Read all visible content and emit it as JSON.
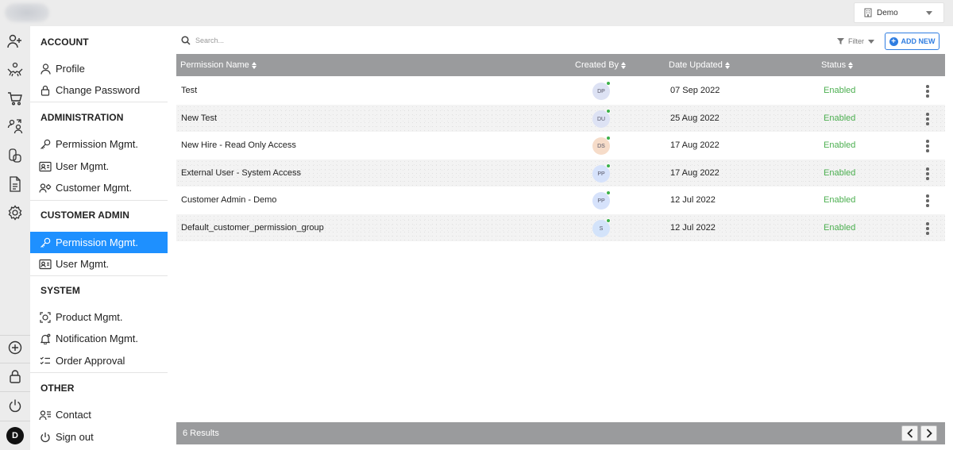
{
  "header": {
    "org_selector": {
      "value": "Demo"
    }
  },
  "rail": {
    "icons": [
      "add-user-icon",
      "handshake-icon",
      "cart-icon",
      "users-switch-icon",
      "coins-icon",
      "document-icon",
      "gear-icon",
      "plus-circle-icon",
      "lock-icon",
      "power-icon"
    ],
    "user_initial": "D"
  },
  "sidebar": {
    "sections": [
      {
        "title": "ACCOUNT",
        "items": [
          {
            "label": "Profile",
            "icon": "user-icon"
          },
          {
            "label": "Change Password",
            "icon": "lock-icon"
          }
        ]
      },
      {
        "title": "ADMINISTRATION",
        "items": [
          {
            "label": "Permission Mgmt.",
            "icon": "key-icon"
          },
          {
            "label": "User Mgmt.",
            "icon": "id-card-icon"
          },
          {
            "label": "Customer Mgmt.",
            "icon": "customer-icon"
          }
        ]
      },
      {
        "title": "CUSTOMER ADMIN",
        "items": [
          {
            "label": "Permission Mgmt.",
            "icon": "key-icon",
            "active": true
          },
          {
            "label": "User Mgmt.",
            "icon": "id-card-icon"
          }
        ]
      },
      {
        "title": "SYSTEM",
        "items": [
          {
            "label": "Product Mgmt.",
            "icon": "product-icon"
          },
          {
            "label": "Notification Mgmt.",
            "icon": "bell-icon"
          },
          {
            "label": "Order Approval",
            "icon": "checklist-icon"
          }
        ]
      },
      {
        "title": "OTHER",
        "items": [
          {
            "label": "Contact",
            "icon": "contact-icon"
          },
          {
            "label": "Sign out",
            "icon": "power-icon"
          }
        ]
      }
    ]
  },
  "toolbar": {
    "search_placeholder": "Search...",
    "filter_label": "Filter",
    "add_label": "ADD NEW"
  },
  "table": {
    "columns": [
      "Permission Name",
      "Created By",
      "Date Updated",
      "Status"
    ],
    "rows": [
      {
        "name": "Test",
        "created_by": "DP",
        "avatar_color": "#dde2f4",
        "date": "07 Sep 2022",
        "status": "Enabled"
      },
      {
        "name": "New Test",
        "created_by": "DU",
        "avatar_color": "#dde2f4",
        "date": "25 Aug 2022",
        "status": "Enabled"
      },
      {
        "name": "New Hire - Read Only Access",
        "created_by": "DS",
        "avatar_color": "#f6dcc9",
        "date": "17 Aug 2022",
        "status": "Enabled"
      },
      {
        "name": "External User - System Access",
        "created_by": "PP",
        "avatar_color": "#d6e2fb",
        "date": "17 Aug 2022",
        "status": "Enabled"
      },
      {
        "name": "Customer Admin - Demo",
        "created_by": "PP",
        "avatar_color": "#d6e2fb",
        "date": "12 Jul 2022",
        "status": "Enabled"
      },
      {
        "name": "Default_customer_permission_group",
        "created_by": "S",
        "avatar_color": "#d3e3fa",
        "date": "12 Jul 2022",
        "status": "Enabled"
      }
    ]
  },
  "footer": {
    "results": "6 Results"
  },
  "colors": {
    "accent": "#1e90ff",
    "status_enabled": "#4caf50",
    "online_dot": "#3cb04a",
    "header_gray": "#9a9b9d"
  }
}
